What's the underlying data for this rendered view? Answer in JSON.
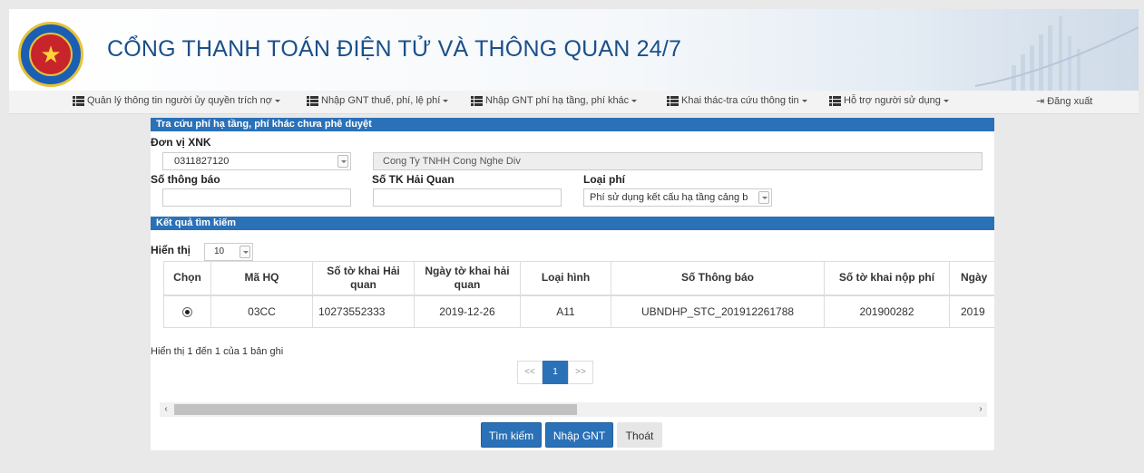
{
  "header": {
    "title": "CỔNG THANH TOÁN ĐIỆN TỬ VÀ THÔNG QUAN 24/7"
  },
  "nav": {
    "items": [
      {
        "label": "Quản lý thông tin người ủy quyền trích nợ"
      },
      {
        "label": "Nhập GNT thuế, phí, lệ phí"
      },
      {
        "label": "Nhập GNT phí hạ tầng, phí khác"
      },
      {
        "label": "Khai thác-tra cứu thông tin"
      },
      {
        "label": "Hỗ trợ người sử dụng"
      }
    ],
    "logout_label": "Đăng xuất"
  },
  "search": {
    "section_title": "Tra cứu phí hạ tầng, phí khác chưa phê duyệt",
    "don_vi_label": "Đơn vị XNK",
    "don_vi_value": "0311827120",
    "company_name": "Cong Ty TNHH Cong Nghe Div",
    "so_thong_bao_label": "Số thông báo",
    "so_thong_bao_value": "",
    "so_tk_label": "Số TK Hải Quan",
    "so_tk_value": "",
    "loai_phi_label": "Loại phí",
    "loai_phi_value": "Phí sử dụng kết cấu hạ tầng cảng b"
  },
  "results": {
    "section_title": "Kết quả tìm kiếm",
    "page_size_label": "Hiển thị",
    "page_size_value": "10",
    "columns": [
      "Chọn",
      "Mã HQ",
      "Số tờ khai Hải quan",
      "Ngày tờ khai hải quan",
      "Loại hình",
      "Số Thông báo",
      "Số tờ khai nộp phí",
      "Ngày"
    ],
    "rows": [
      {
        "ma_hq": "03CC",
        "so_tk": "10273552333",
        "ngay_tk": "2019-12-26",
        "loai_hinh": "A11",
        "so_thong_bao": "UBNDHP_STC_201912261788",
        "so_tk_nop_phi": "201900282",
        "ngay": "2019",
        "selected": true
      }
    ],
    "summary": "Hiển thị 1 đến 1 của 1 bản ghi",
    "pager": {
      "prev": "<<",
      "current": "1",
      "next": ">>"
    }
  },
  "scrollbar": {
    "left_arrow": "‹",
    "right_arrow": "›"
  },
  "buttons": {
    "search": "Tìm kiếm",
    "create": "Nhập GNT",
    "exit": "Thoát"
  },
  "colors": {
    "primary": "#2a71b8",
    "title": "#1b4f8a",
    "background": "#e9e9ea"
  }
}
